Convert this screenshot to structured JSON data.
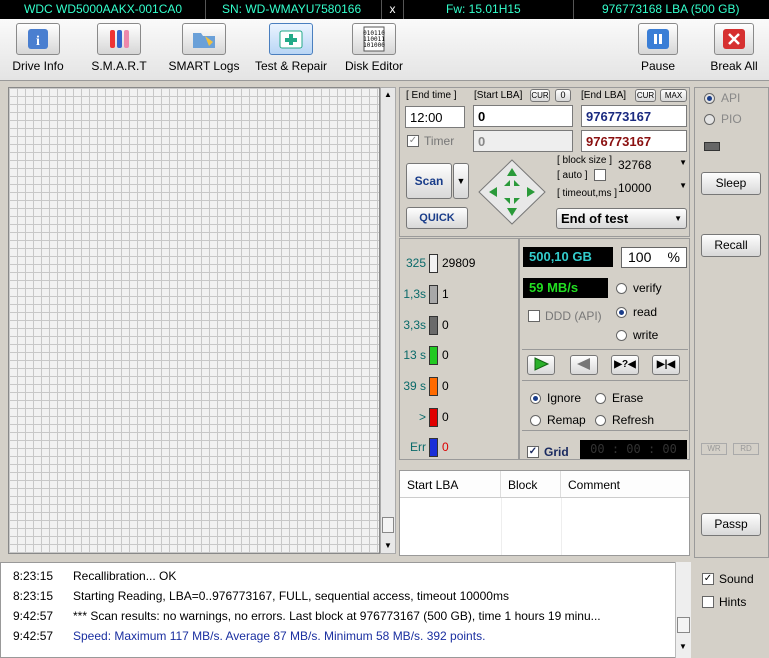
{
  "status_bar": {
    "model": "WDC WD5000AAKX-001CA0",
    "serial": "SN: WD-WMAYU7580166",
    "close": "x",
    "firmware": "Fw: 15.01H15",
    "lba": "976773168 LBA (500 GB)"
  },
  "toolbar": {
    "drive_info": "Drive Info",
    "smart": "S.M.A.R.T",
    "smart_logs": "SMART Logs",
    "test_repair": "Test & Repair",
    "disk_editor": "Disk Editor",
    "pause": "Pause",
    "break_all": "Break All"
  },
  "controls": {
    "end_time_label": "[ End time ]",
    "start_lba_label": "[Start LBA]",
    "cur": "CUR",
    "zero": "0",
    "end_lba_label": "[End LBA]",
    "cur2": "CUR",
    "max": "MAX",
    "end_time": "12:00",
    "start_lba": "0",
    "end_lba": "976773167",
    "timer_label": "Timer",
    "timer_value": "0",
    "end_lba2": "976773167",
    "block_size_label": "[ block size ]",
    "auto_label": "[ auto ]",
    "timeout_label": "[ timeout,ms ]",
    "block_size": "32768",
    "timeout": "10000",
    "scan": "Scan",
    "quick": "QUICK",
    "end_action": "End of test"
  },
  "legend": [
    {
      "label": "325",
      "count": "29809",
      "color": "#f2f2f2"
    },
    {
      "label": "1,3s",
      "count": "1",
      "color": "#a8a8a8"
    },
    {
      "label": "3,3s",
      "count": "0",
      "color": "#6a6a6a"
    },
    {
      "label": "13 s",
      "count": "0",
      "color": "#22c922"
    },
    {
      "label": "39 s",
      "count": "0",
      "color": "#ff6a00"
    },
    {
      "label": ">",
      "count": "0",
      "color": "#e00000"
    },
    {
      "label": "Err",
      "count": "0",
      "color": "#1a2fd8"
    }
  ],
  "stats": {
    "size": "500,10 GB",
    "percent": "100",
    "percent_unit": "%",
    "speed": "59 MB/s",
    "ddd": "DDD (API)",
    "verify": "verify",
    "read": "read",
    "write": "write"
  },
  "actions": {
    "ignore": "Ignore",
    "erase": "Erase",
    "remap": "Remap",
    "refresh": "Refresh",
    "grid": "Grid",
    "timer_display": "00 : 00 : 00"
  },
  "table": {
    "headers": [
      "Start LBA",
      "Block",
      "Comment"
    ]
  },
  "right": {
    "api": "API",
    "pio": "PIO",
    "sleep": "Sleep",
    "recall": "Recall",
    "wr": "WR",
    "rd": "RD",
    "passp": "Passp",
    "sound": "Sound",
    "hints": "Hints"
  },
  "log": [
    {
      "time": "8:23:15",
      "text": "Recallibration... OK"
    },
    {
      "time": "8:23:15",
      "text": "Starting Reading, LBA=0..976773167, FULL, sequential access, timeout 10000ms"
    },
    {
      "time": "9:42:57",
      "text": "*** Scan results: no warnings, no errors. Last block at 976773167 (500 GB), time 1 hours 19 minu..."
    },
    {
      "time": "9:42:57",
      "text": "Speed: Maximum 117 MB/s. Average 87 MB/s. Minimum 58 MB/s. 392 points."
    }
  ]
}
